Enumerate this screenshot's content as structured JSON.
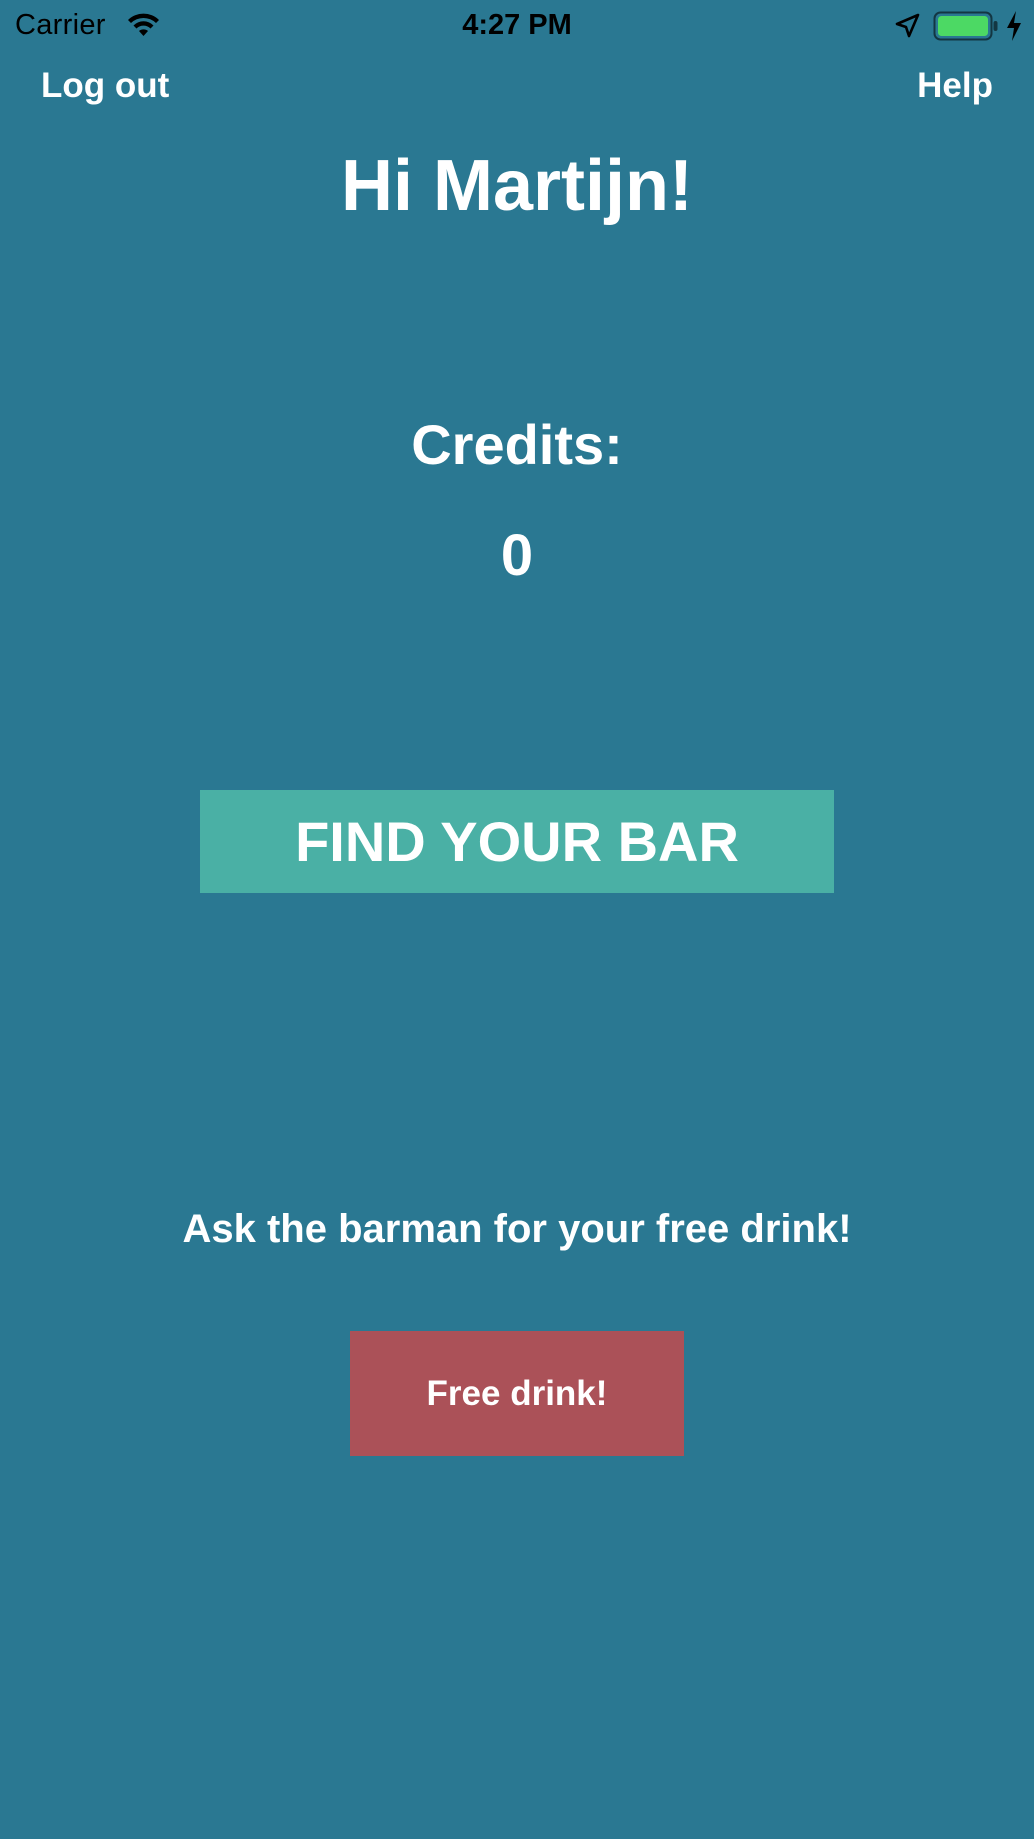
{
  "status_bar": {
    "carrier": "Carrier",
    "time": "4:27 PM",
    "wifi_icon": "wifi-icon",
    "location_icon": "location-arrow-icon",
    "battery_icon": "battery-icon",
    "battery_level": 1.0,
    "battery_color": "#4cd964",
    "charging_icon": "charging-bolt-icon"
  },
  "nav": {
    "logout_label": "Log out",
    "help_label": "Help"
  },
  "main": {
    "greeting": "Hi Martijn!",
    "credits_label": "Credits:",
    "credits_value": "0",
    "find_bar_label": "FIND YOUR BAR",
    "free_drink_message": "Ask the barman for your free drink!",
    "free_drink_label": "Free drink!"
  },
  "colors": {
    "background": "#2a7892",
    "find_bar_button": "#4ab0a5",
    "free_drink_button": "#ab5158",
    "text": "#ffffff"
  }
}
